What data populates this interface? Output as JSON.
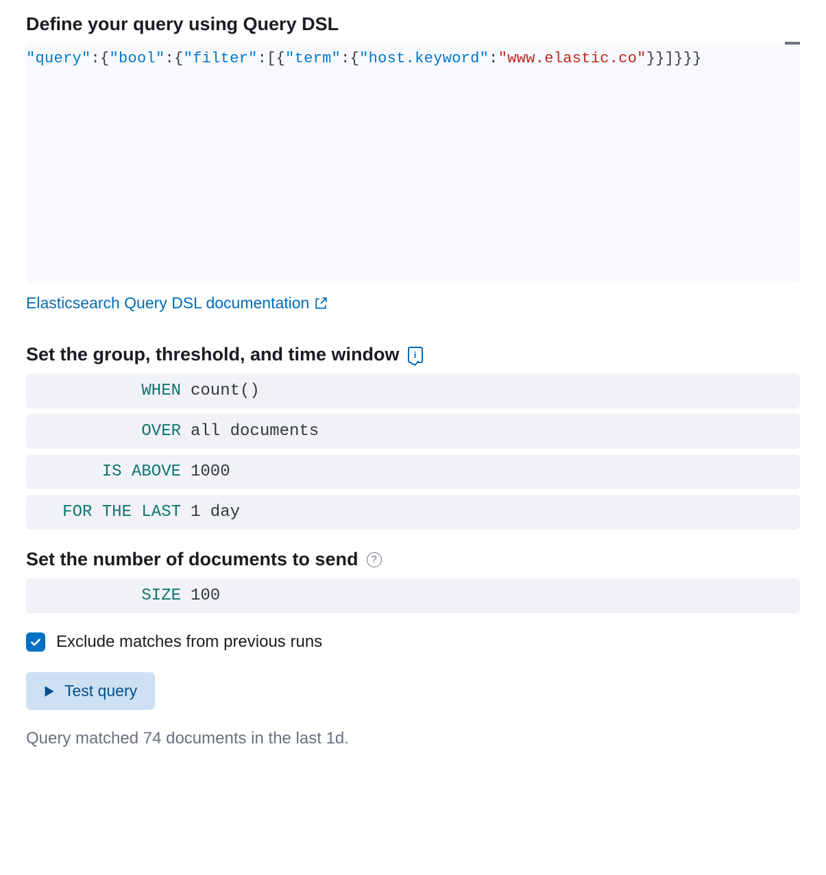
{
  "querySection": {
    "title": "Define your query using Query DSL",
    "codeTokens": [
      {
        "t": "key",
        "v": "\"query\""
      },
      {
        "t": "punc",
        "v": ":{"
      },
      {
        "t": "key",
        "v": "\"bool\""
      },
      {
        "t": "punc",
        "v": ":{"
      },
      {
        "t": "key",
        "v": "\"filter\""
      },
      {
        "t": "punc",
        "v": ":[{"
      },
      {
        "t": "key",
        "v": "\"term\""
      },
      {
        "t": "punc",
        "v": ":{"
      },
      {
        "t": "key",
        "v": "\"host.keyword\""
      },
      {
        "t": "punc",
        "v": ":"
      },
      {
        "t": "str",
        "v": "\"www.elastic.co\""
      },
      {
        "t": "punc",
        "v": "}}]}}}"
      }
    ],
    "docLinkLabel": "Elasticsearch Query DSL documentation"
  },
  "groupSection": {
    "title": "Set the group, threshold, and time window",
    "rows": [
      {
        "label": "WHEN",
        "value": "count()"
      },
      {
        "label": "OVER",
        "value": "all documents"
      },
      {
        "label": "IS ABOVE",
        "value": "1000"
      },
      {
        "label": "FOR THE LAST",
        "value": "1 day"
      }
    ]
  },
  "sizeSection": {
    "title": "Set the number of documents to send",
    "row": {
      "label": "SIZE",
      "value": "100"
    }
  },
  "excludeCheckbox": {
    "label": "Exclude matches from previous runs",
    "checked": true
  },
  "testButton": {
    "label": "Test query"
  },
  "resultText": "Query matched 74 documents in the last 1d."
}
